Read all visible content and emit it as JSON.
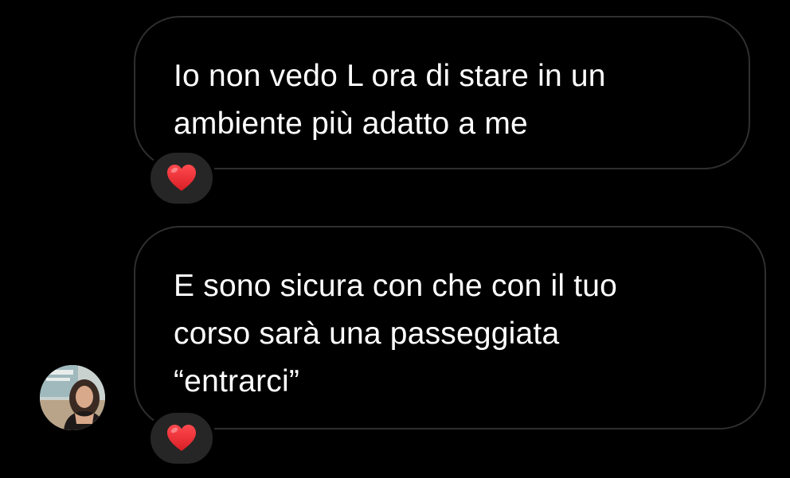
{
  "messages": [
    {
      "text": "Io non vedo L ora di stare in un\nambiente più adatto a me",
      "reaction": "heart-icon"
    },
    {
      "text": "E sono sicura con che con il tuo\ncorso sarà una passeggiata\n“entrarci”",
      "reaction": "heart-icon"
    }
  ],
  "colors": {
    "background": "#000000",
    "bubble_border": "#2f2f2f",
    "reaction_pill": "#262626",
    "heart": "#e0242b"
  }
}
